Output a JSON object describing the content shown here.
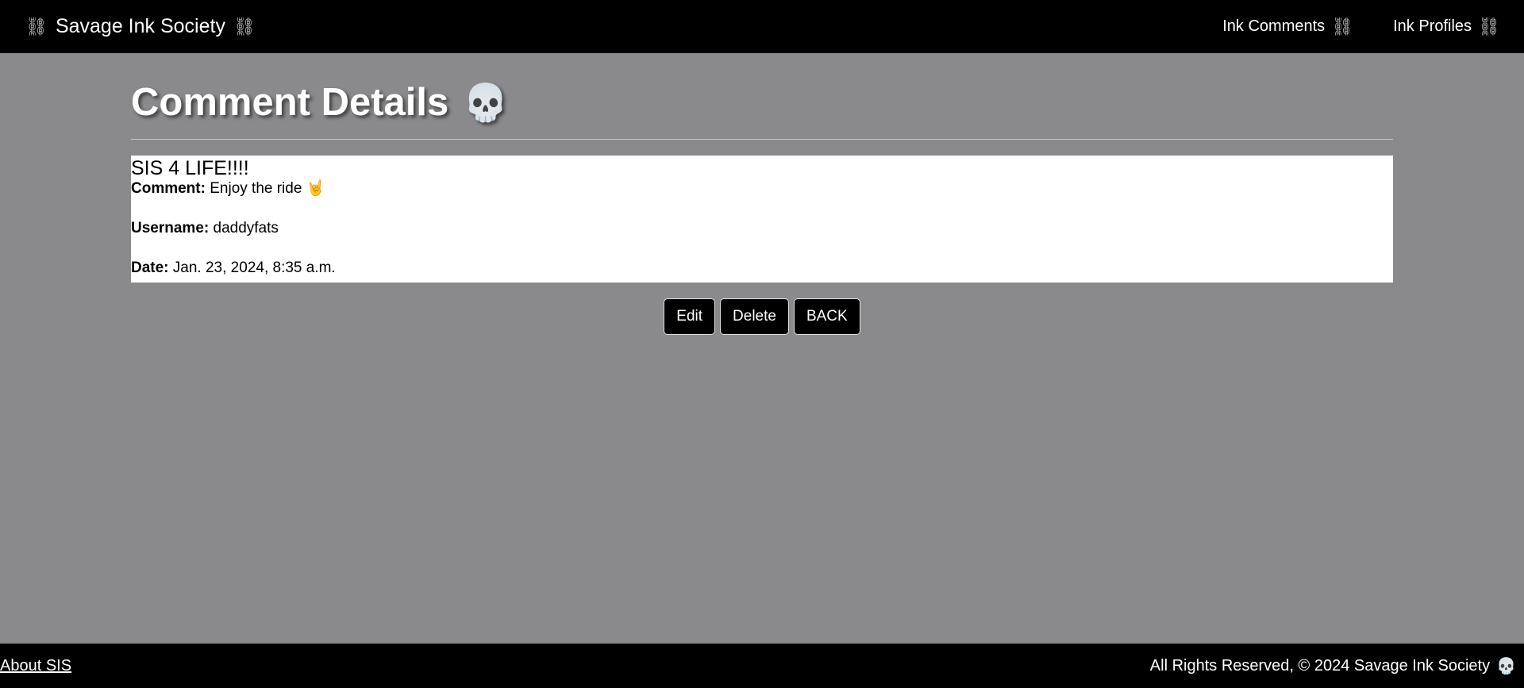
{
  "navbar": {
    "brand": "Savage Ink Society",
    "brand_icon": "⛓",
    "links": [
      {
        "label": "Ink Comments",
        "icon": "⛓"
      },
      {
        "label": "Ink Profiles",
        "icon": "⛓"
      }
    ]
  },
  "main": {
    "title": "Comment Details",
    "title_icon": "💀",
    "comment": {
      "title": "SIS 4 LIFE!!!!",
      "comment_label": "Comment:",
      "comment_value": "Enjoy the ride 🤘",
      "username_label": "Username:",
      "username_value": "daddyfats",
      "date_label": "Date:",
      "date_value": "Jan. 23, 2024, 8:35 a.m."
    },
    "buttons": {
      "edit": "Edit",
      "delete": "Delete",
      "back": "BACK"
    }
  },
  "footer": {
    "about": "About SIS",
    "copyright": "All Rights Reserved, © 2024 Savage Ink Society",
    "icon": "💀"
  },
  "colors": {
    "background": "#8a8a8c",
    "bars": "#000000",
    "card": "#ffffff"
  }
}
